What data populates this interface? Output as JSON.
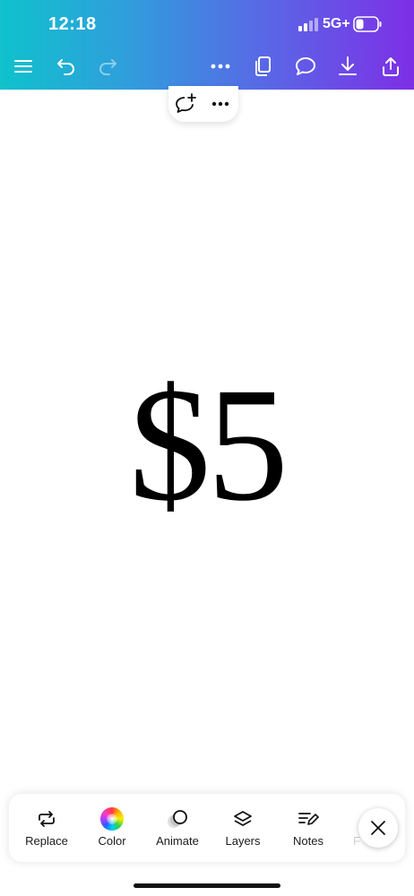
{
  "status_bar": {
    "time": "12:18",
    "network": "5G+"
  },
  "toolbar": {
    "icons": [
      "menu-icon",
      "undo-icon",
      "redo-icon",
      "more-icon",
      "pages-icon",
      "comment-icon",
      "download-icon",
      "share-icon"
    ]
  },
  "float_menu": {
    "icons": [
      "add-comment-icon",
      "more-icon"
    ]
  },
  "canvas": {
    "text": "$5"
  },
  "bottom_tools": [
    {
      "label": "Replace",
      "icon": "replace-icon"
    },
    {
      "label": "Color",
      "icon": "color-wheel-icon"
    },
    {
      "label": "Animate",
      "icon": "animate-icon"
    },
    {
      "label": "Layers",
      "icon": "layers-icon"
    },
    {
      "label": "Notes",
      "icon": "notes-icon"
    },
    {
      "label": "F",
      "icon": ""
    }
  ],
  "colors": {
    "gradient_start": "#0fc2cc",
    "gradient_end": "#7d2fe6"
  }
}
